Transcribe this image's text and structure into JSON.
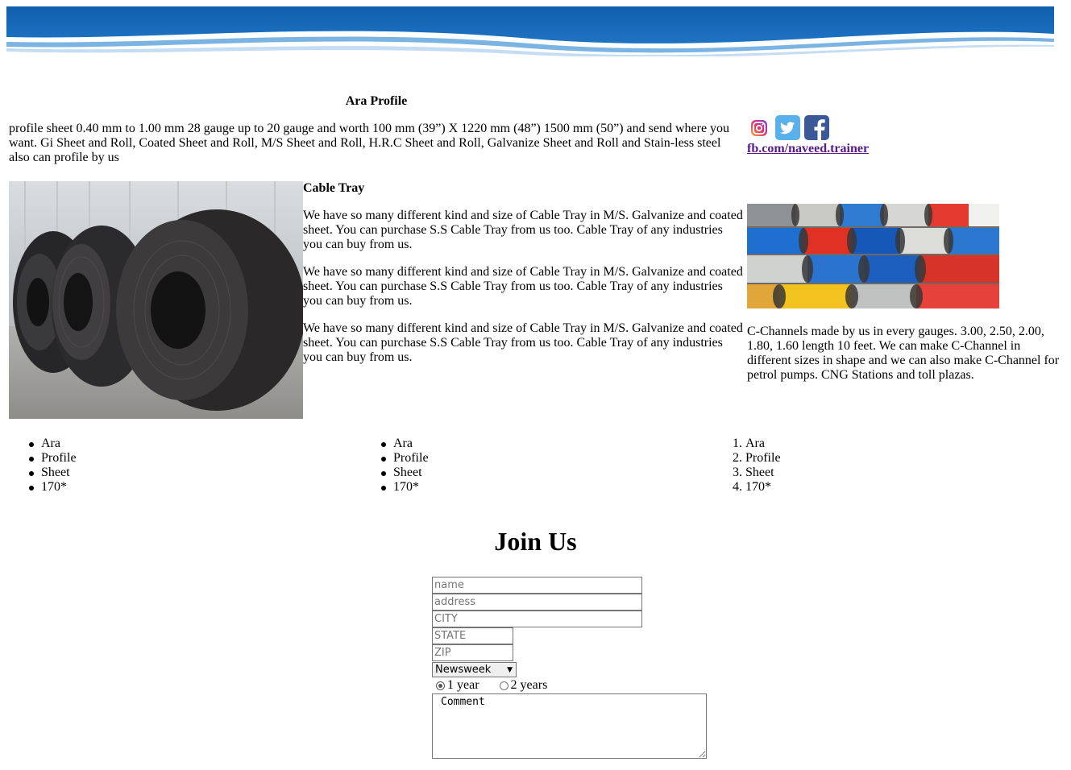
{
  "header": {
    "banner_icon": "wave-banner",
    "banner_colors": {
      "dark": "#1565b5",
      "light": "#4e9ad8"
    }
  },
  "title": "Ara Profile",
  "intro": "profile sheet 0.40 mm to 1.00 mm 28 gauge up to 20 gauge and worth 100 mm (39”) X 1220 mm (48”) 1500 mm (50”) and send where you want. Gi Sheet and Roll, Coated Sheet and Roll, M/S Sheet and Roll, H.R.C Sheet and Roll, Galvanize Sheet and Roll and Stain-less steel also can profile by us",
  "social": {
    "icons": [
      "instagram-icon",
      "twitter-icon",
      "facebook-icon"
    ],
    "link_text": "fb.com/naveed.trainer"
  },
  "images": {
    "left": "steel-coils-photo",
    "right": "painted-coils-photo"
  },
  "cable_tray": {
    "heading": "Cable Tray",
    "paragraphs": [
      "We have so many different kind and size of Cable Tray in M/S. Galvanize and coated sheet. You can purchase S.S Cable Tray from us too. Cable Tray of any industries you can buy from us.",
      "We have so many different kind and size of Cable Tray in M/S. Galvanize and coated sheet. You can purchase S.S Cable Tray from us too. Cable Tray of any industries you can buy from us.",
      "We have so many different kind and size of Cable Tray in M/S. Galvanize and coated sheet. You can purchase S.S Cable Tray from us too. Cable Tray of any industries you can buy from us."
    ]
  },
  "c_channels": "C-Channels made by us in every gauges. 3.00, 2.50, 2.00, 1.80, 1.60 length 10 feet. We can make C-Channel in different sizes in shape and we can also make C-Channel for petrol pumps. CNG Stations and toll plazas.",
  "lists": {
    "list1": [
      "Ara",
      "Profile",
      "Sheet",
      "170*"
    ],
    "list2": [
      "Ara",
      "Profile",
      "Sheet",
      "170*"
    ],
    "list3": [
      {
        "num": "1.",
        "text": "Ara"
      },
      {
        "num": "2.",
        "text": "Profile"
      },
      {
        "num": "3.",
        "text": "Sheet"
      },
      {
        "num": "4.",
        "text": "170*"
      }
    ]
  },
  "form": {
    "heading": "Join Us",
    "name_placeholder": "name",
    "address_placeholder": "address",
    "city_placeholder": "CITY",
    "state_placeholder": "STATE",
    "zip_placeholder": "ZIP",
    "select_value": "Newsweek",
    "radio1": "1 year",
    "radio2": "2 years",
    "comment": "Comment"
  }
}
